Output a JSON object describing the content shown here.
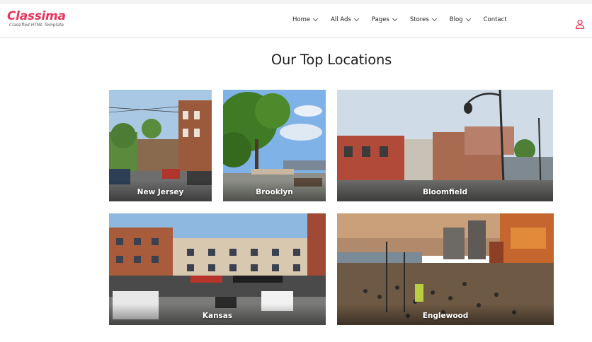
{
  "brand": {
    "name": "Classima",
    "tagline": "Classified HTML Template",
    "accent": "#e6365a"
  },
  "nav": [
    {
      "label": "Home",
      "dropdown": true
    },
    {
      "label": "All Ads",
      "dropdown": true
    },
    {
      "label": "Pages",
      "dropdown": true
    },
    {
      "label": "Stores",
      "dropdown": true
    },
    {
      "label": "Blog",
      "dropdown": true
    },
    {
      "label": "Contact",
      "dropdown": false
    }
  ],
  "user_icon": "user-icon",
  "section": {
    "title": "Our Top Locations"
  },
  "locations": [
    {
      "name": "New Jersey"
    },
    {
      "name": "Brooklyn"
    },
    {
      "name": "Bloomfield"
    },
    {
      "name": "Kansas"
    },
    {
      "name": "Englewood"
    }
  ]
}
